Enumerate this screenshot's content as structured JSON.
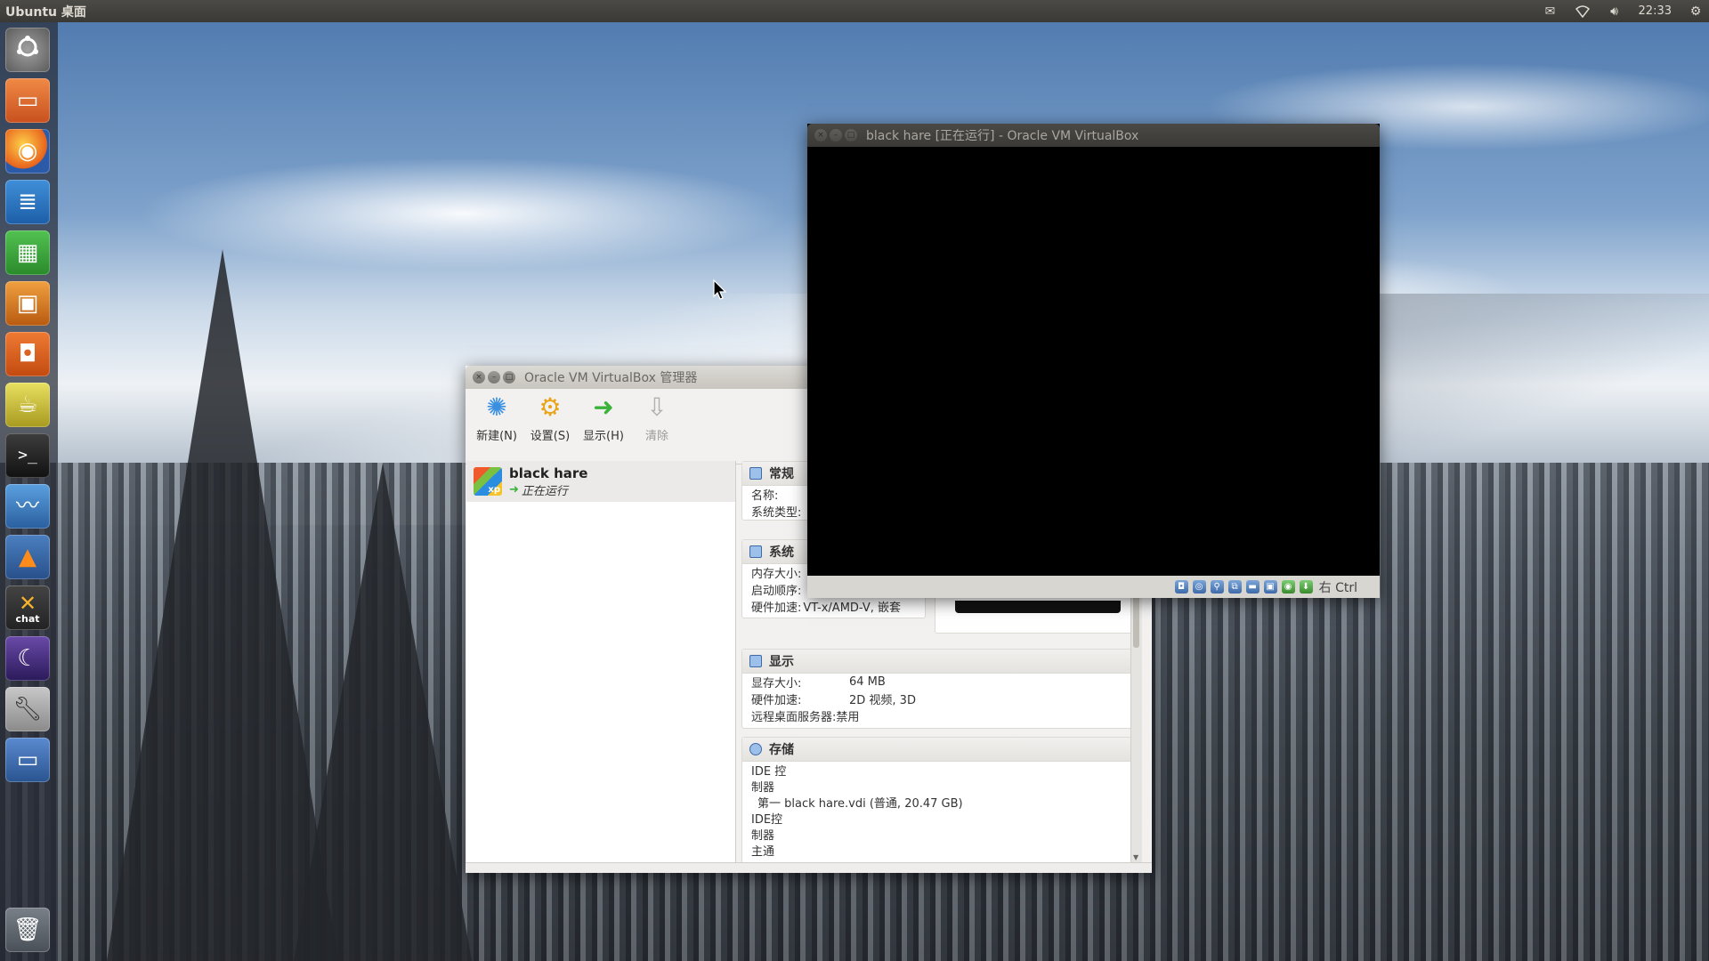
{
  "top_panel": {
    "title": "Ubuntu 桌面",
    "clock": "22:33",
    "icons": [
      "mail-icon",
      "wifi-icon",
      "volume-icon",
      "gear-icon"
    ]
  },
  "launcher": {
    "items": [
      {
        "name": "dash-home",
        "icon": "ubuntu-logo-icon"
      },
      {
        "name": "files",
        "icon": "folder-icon"
      },
      {
        "name": "firefox",
        "icon": "firefox-icon"
      },
      {
        "name": "libreoffice-writer",
        "icon": "writer-icon"
      },
      {
        "name": "libreoffice-calc",
        "icon": "calc-icon"
      },
      {
        "name": "libreoffice-impress",
        "icon": "impress-icon"
      },
      {
        "name": "software-center",
        "icon": "shopping-bag-icon"
      },
      {
        "name": "system-tools",
        "icon": "teapot-icon"
      },
      {
        "name": "terminal",
        "icon": "terminal-icon"
      },
      {
        "name": "system-monitor",
        "icon": "monitor-icon"
      },
      {
        "name": "vlc",
        "icon": "traffic-cone-icon"
      },
      {
        "name": "xchat",
        "icon": "xchat-icon",
        "label": "chat"
      },
      {
        "name": "night-app",
        "icon": "moon-icon"
      },
      {
        "name": "system-settings",
        "icon": "wrench-icon"
      },
      {
        "name": "virtualbox",
        "icon": "window-icon"
      },
      {
        "name": "trash",
        "icon": "trash-icon"
      }
    ]
  },
  "vm_window": {
    "title": "black hare [正在运行] - Oracle VM VirtualBox",
    "host_key": "右 Ctrl"
  },
  "manager": {
    "title": "Oracle VM VirtualBox 管理器",
    "toolbar": {
      "new": "新建(N)",
      "settings": "设置(S)",
      "show": "显示(H)",
      "discard": "清除"
    },
    "vm_list": [
      {
        "name": "black hare",
        "state": "正在运行",
        "os_badge": "xp"
      }
    ],
    "details": {
      "general": {
        "title": "常规",
        "name_label": "名称:",
        "os_label": "系统类型:"
      },
      "system": {
        "title": "系统",
        "memory_label": "内存大小:",
        "boot_label": "启动顺序:",
        "accel_label": "硬件加速:",
        "accel_value": "VT-x/AMD-V, 嵌套"
      },
      "display": {
        "title": "显示",
        "vram_label": "显存大小:",
        "vram_value": "64 MB",
        "accel_label": "硬件加速:",
        "accel_value": "2D 视频, 3D",
        "rdp_label": "远程桌面服务器:",
        "rdp_value": "禁用"
      },
      "storage": {
        "title": "存储",
        "lines": [
          "IDE 控",
          "制器",
          "第一  black hare.vdi (普通, 20.47 GB)",
          "IDE控",
          "制器",
          "主通"
        ]
      }
    }
  }
}
